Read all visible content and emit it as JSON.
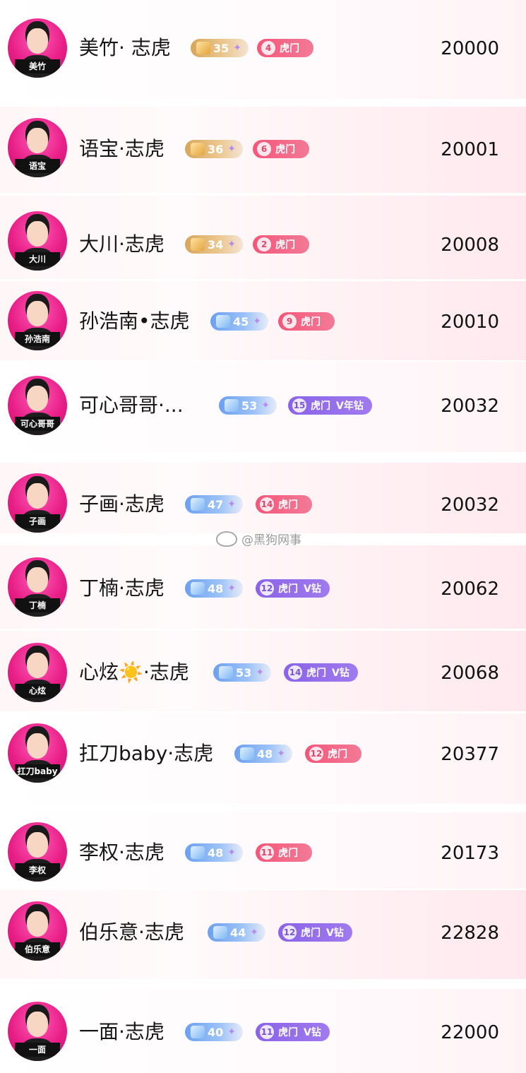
{
  "watermark": "@黑狗网事",
  "rows": [
    {
      "name": "美竹· 志虎",
      "tag": "美竹",
      "level": "35",
      "level_style": "gold",
      "club_num": "4",
      "club": "虎门",
      "vip": "",
      "club_style": "pink",
      "score": "20000"
    },
    {
      "name": "语宝·志虎",
      "tag": "语宝",
      "level": "36",
      "level_style": "gold",
      "club_num": "6",
      "club": "虎门",
      "vip": "",
      "club_style": "pink",
      "score": "20001"
    },
    {
      "name": "大川·志虎",
      "tag": "大川",
      "level": "34",
      "level_style": "gold",
      "club_num": "2",
      "club": "虎门",
      "vip": "",
      "club_style": "pink",
      "score": "20008"
    },
    {
      "name": "孙浩南•志虎",
      "tag": "孙浩南",
      "level": "45",
      "level_style": "blue",
      "club_num": "9",
      "club": "虎门",
      "vip": "",
      "club_style": "pink",
      "score": "20010"
    },
    {
      "name": "可心哥哥·...",
      "tag": "可心哥哥",
      "level": "53",
      "level_style": "blue",
      "club_num": "15",
      "club": "虎门",
      "vip": "V年钻",
      "club_style": "purple",
      "score": "20032"
    },
    {
      "name": "子画·志虎",
      "tag": "子画",
      "level": "47",
      "level_style": "blue",
      "club_num": "14",
      "club": "虎门",
      "vip": "",
      "club_style": "pink",
      "score": "20032"
    },
    {
      "name": "丁楠·志虎",
      "tag": "丁楠",
      "level": "48",
      "level_style": "blue",
      "club_num": "12",
      "club": "虎门",
      "vip": "V钻",
      "club_style": "purple",
      "score": "20062"
    },
    {
      "name": "心炫☀️·志虎",
      "tag": "心炫",
      "level": "53",
      "level_style": "blue",
      "club_num": "14",
      "club": "虎门",
      "vip": "V钻",
      "club_style": "purple",
      "score": "20068"
    },
    {
      "name": "扛刀baby·志虎",
      "tag": "扛刀baby",
      "level": "48",
      "level_style": "blue",
      "club_num": "12",
      "club": "虎门",
      "vip": "",
      "club_style": "pink",
      "score": "20377"
    },
    {
      "name": "李权·志虎",
      "tag": "李权",
      "level": "48",
      "level_style": "blue",
      "club_num": "11",
      "club": "虎门",
      "vip": "",
      "club_style": "pink",
      "score": "20173"
    },
    {
      "name": "伯乐意·志虎",
      "tag": "伯乐意",
      "level": "44",
      "level_style": "blue",
      "club_num": "12",
      "club": "虎门",
      "vip": "V钻",
      "club_style": "purple",
      "score": "22828"
    },
    {
      "name": "一面·志虎",
      "tag": "一面",
      "level": "40",
      "level_style": "blue",
      "club_num": "11",
      "club": "虎门",
      "vip": "V钻",
      "club_style": "purple",
      "score": "22000"
    }
  ]
}
